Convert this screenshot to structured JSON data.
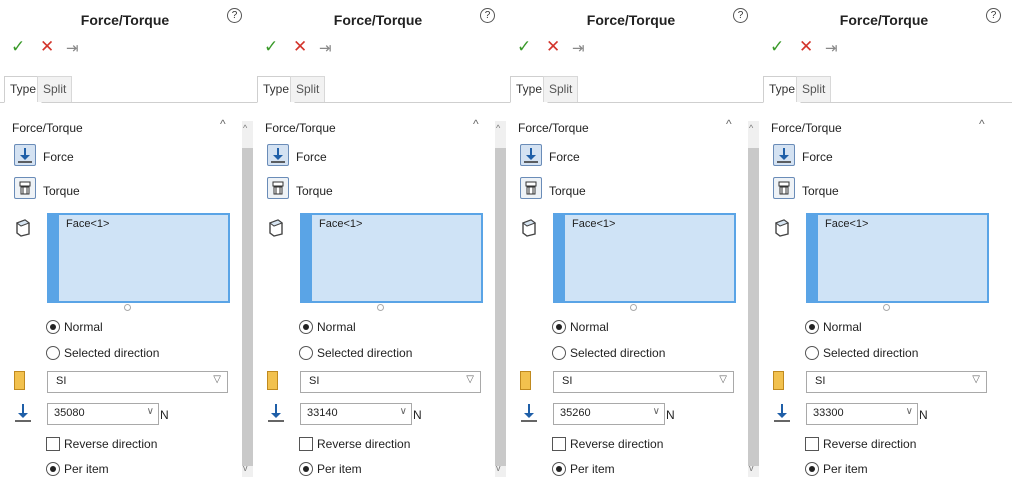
{
  "panels": [
    {
      "title": "Force/Torque",
      "tabs": [
        "Type",
        "Split"
      ],
      "group": "Force/Torque",
      "force_label": "Force",
      "torque_label": "Torque",
      "selection": "Face<1>",
      "normal_label": "Normal",
      "selected_direction_label": "Selected direction",
      "units": "SI",
      "value": "35080",
      "unit": "N",
      "reverse_label": "Reverse direction",
      "per_item_label": "Per item"
    },
    {
      "title": "Force/Torque",
      "tabs": [
        "Type",
        "Split"
      ],
      "group": "Force/Torque",
      "force_label": "Force",
      "torque_label": "Torque",
      "selection": "Face<1>",
      "normal_label": "Normal",
      "selected_direction_label": "Selected direction",
      "units": "SI",
      "value": "33140",
      "unit": "N",
      "reverse_label": "Reverse direction",
      "per_item_label": "Per item"
    },
    {
      "title": "Force/Torque",
      "tabs": [
        "Type",
        "Split"
      ],
      "group": "Force/Torque",
      "force_label": "Force",
      "torque_label": "Torque",
      "selection": "Face<1>",
      "normal_label": "Normal",
      "selected_direction_label": "Selected direction",
      "units": "SI",
      "value": "35260",
      "unit": "N",
      "reverse_label": "Reverse direction",
      "per_item_label": "Per item"
    },
    {
      "title": "Force/Torque",
      "tabs": [
        "Type",
        "Split"
      ],
      "group": "Force/Torque",
      "force_label": "Force",
      "torque_label": "Torque",
      "selection": "Face<1>",
      "normal_label": "Normal",
      "selected_direction_label": "Selected direction",
      "units": "SI",
      "value": "33300",
      "unit": "N",
      "reverse_label": "Reverse direction",
      "per_item_label": "Per item"
    }
  ],
  "colors": {
    "accept": "#3a9a2a",
    "cancel": "#d3342b",
    "selection_fill": "#cfe3f6",
    "selection_border": "#5aa4e6"
  },
  "icons": [
    "help-icon",
    "accept-check-icon",
    "cancel-x-icon",
    "pin-icon",
    "force-icon",
    "torque-icon",
    "face-selection-icon",
    "unit-system-icon",
    "force-magnitude-icon"
  ]
}
